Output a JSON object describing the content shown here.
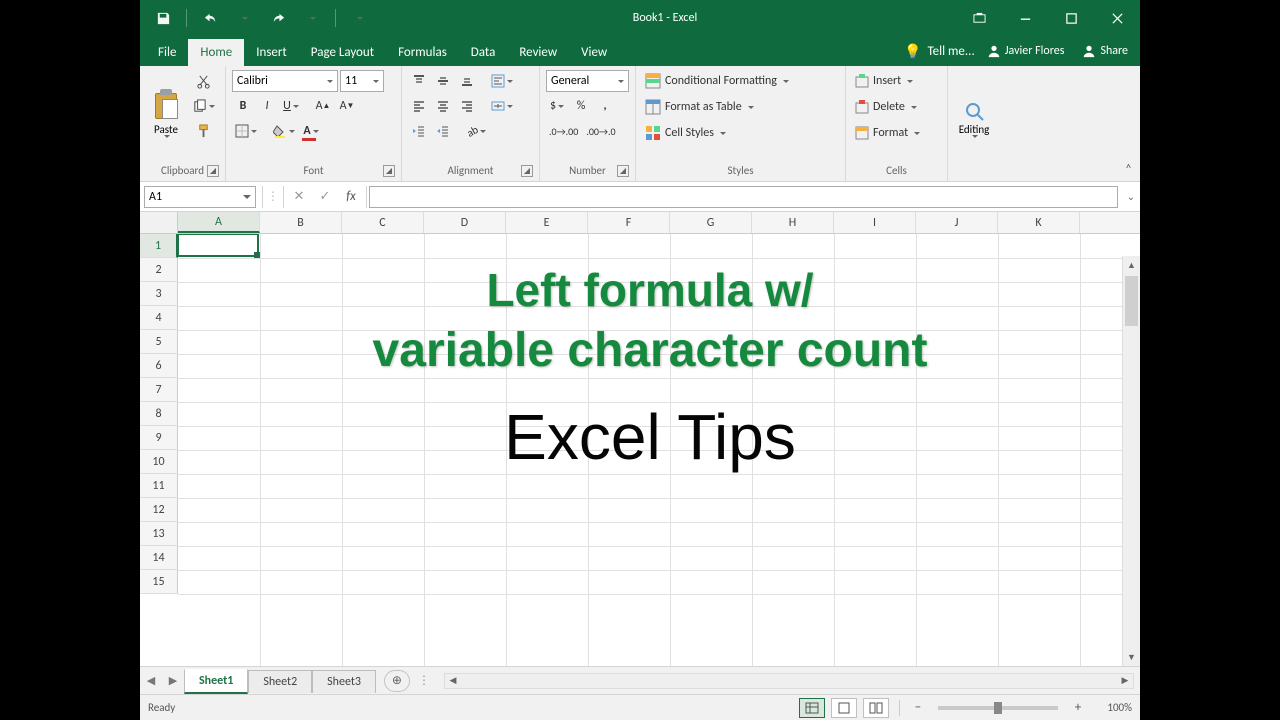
{
  "titlebar": {
    "title": "Book1 - Excel"
  },
  "tabs": {
    "items": [
      "File",
      "Home",
      "Insert",
      "Page Layout",
      "Formulas",
      "Data",
      "Review",
      "View"
    ],
    "active": 1,
    "tellme": "Tell me...",
    "user": "Javier Flores",
    "share": "Share"
  },
  "ribbon": {
    "clipboard": {
      "paste": "Paste",
      "label": "Clipboard"
    },
    "font": {
      "name": "Calibri",
      "size": "11",
      "label": "Font"
    },
    "alignment": {
      "label": "Alignment"
    },
    "number": {
      "format": "General",
      "label": "Number"
    },
    "styles": {
      "conditional": "Conditional Formatting",
      "table": "Format as Table",
      "cell": "Cell Styles",
      "label": "Styles"
    },
    "cells": {
      "insert": "Insert",
      "delete": "Delete",
      "format": "Format",
      "label": "Cells"
    },
    "editing": {
      "label": "Editing"
    }
  },
  "formula_bar": {
    "name_box": "A1",
    "fx": "fx",
    "value": ""
  },
  "grid": {
    "columns": [
      "A",
      "B",
      "C",
      "D",
      "E",
      "F",
      "G",
      "H",
      "I",
      "J",
      "K"
    ],
    "row_count": 15,
    "selected_cell": "A1"
  },
  "overlay": {
    "line1": "Left formula w/",
    "line2": "variable character count",
    "line3": "Excel Tips"
  },
  "sheets": {
    "tabs": [
      "Sheet1",
      "Sheet2",
      "Sheet3"
    ],
    "active": 0
  },
  "status": {
    "ready": "Ready",
    "zoom": "100%"
  }
}
